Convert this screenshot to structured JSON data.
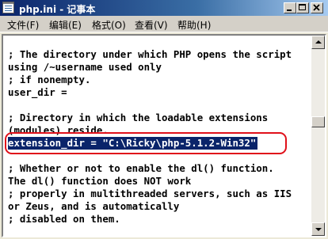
{
  "window": {
    "title": "php.ini - 记事本"
  },
  "menu": [
    {
      "label": "文件(F)"
    },
    {
      "label": "编辑(E)"
    },
    {
      "label": "格式(O)"
    },
    {
      "label": "查看(V)"
    },
    {
      "label": "帮助(H)"
    }
  ],
  "editor": {
    "lines": [
      "",
      "; The directory under which PHP opens the script",
      "using /~username used only",
      "; if nonempty.",
      "user_dir =",
      "",
      "; Directory in which the loadable extensions",
      "(modules) reside.",
      "extension_dir = \"C:\\Ricky\\php-5.1.2-Win32\"",
      "",
      "; Whether or not to enable the dl() function.",
      "The dl() function does NOT work",
      "; properly in multithreaded servers, such as IIS",
      "or Zeus, and is automatically",
      "; disabled on them."
    ],
    "selected_line_index": 8
  },
  "colors": {
    "titlebar_start": "#0a246a",
    "titlebar_end": "#a6caf0",
    "selection": "#0a246a",
    "annotation_ring": "#e0101a"
  },
  "icons": {
    "app": "notepad-icon",
    "minimize": "minimize-icon",
    "maximize": "maximize-icon",
    "close": "close-icon",
    "scroll_up": "arrow-up-icon",
    "scroll_down": "arrow-down-icon"
  }
}
